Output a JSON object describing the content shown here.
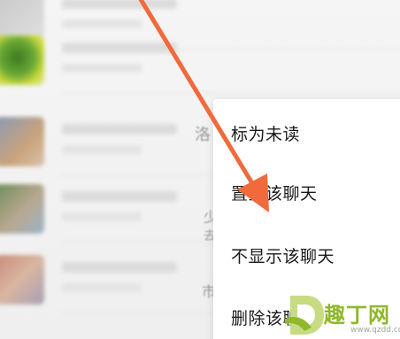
{
  "background": {
    "partial_chars": [
      "洛",
      "少",
      "去",
      "市"
    ]
  },
  "context_menu": {
    "items": [
      {
        "label": "标为未读"
      },
      {
        "label": "置顶该聊天"
      },
      {
        "label": "不显示该聊天"
      },
      {
        "label": "删除该聊天"
      }
    ]
  },
  "annotation": {
    "arrow_color": "#f06a3c"
  },
  "watermark": {
    "name": "趣丁网",
    "url": "www.qzdd.com"
  }
}
